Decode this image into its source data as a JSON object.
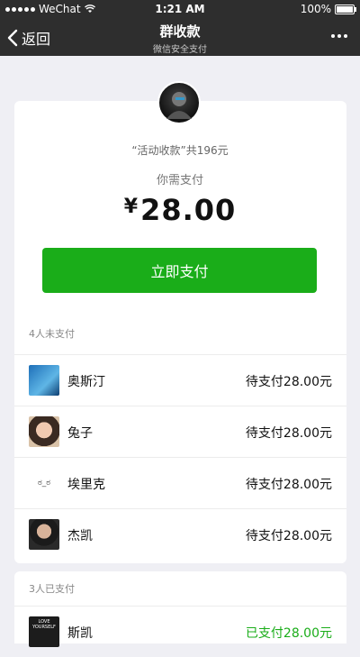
{
  "status_bar": {
    "carrier": "WeChat",
    "time": "1:21 AM",
    "battery": "100%",
    "battery_level": 1.0
  },
  "nav": {
    "back_label": "返回",
    "title": "群收款",
    "subtitle": "微信安全支付"
  },
  "summary": {
    "activity": "“活动收款”共196元",
    "need_pay_label": "你需支付",
    "currency": "¥",
    "amount": "28.00",
    "pay_button": "立即支付"
  },
  "unpaid": {
    "title": "4人未支付",
    "items": [
      {
        "name": "奥斯汀",
        "status": "待支付28.00元"
      },
      {
        "name": "兔子",
        "status": "待支付28.00元"
      },
      {
        "name": "埃里克",
        "status": "待支付28.00元",
        "avatar_text": "ಠ_ಠ"
      },
      {
        "name": "杰凯",
        "status": "待支付28.00元"
      }
    ]
  },
  "paid": {
    "title": "3人已支付",
    "items": [
      {
        "name": "斯凯",
        "status": "已支付28.00元",
        "avatar_text": "LOVE YOURSELF"
      }
    ]
  },
  "colors": {
    "accent": "#1aad19",
    "header": "#2e2e2e",
    "background": "#efeff4"
  }
}
